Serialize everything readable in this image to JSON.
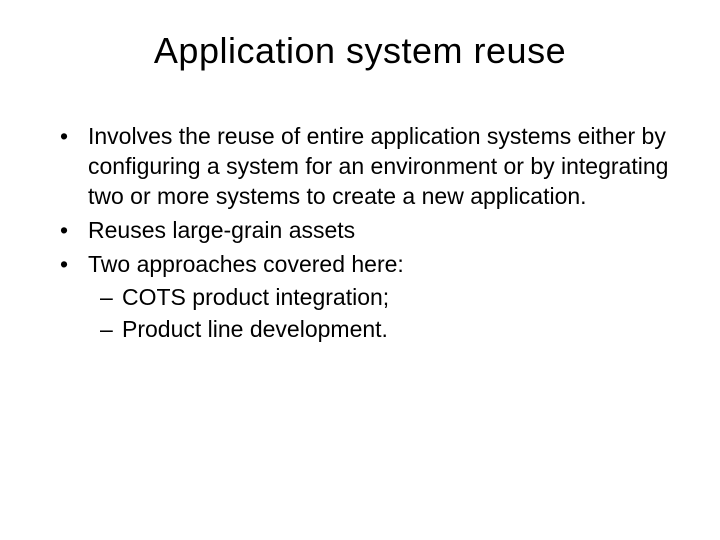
{
  "title": "Application system reuse",
  "bullets": [
    "Involves the reuse of entire application systems either by configuring a system for an environment or by integrating two or more systems to create a new application.",
    "Reuses large-grain assets",
    "Two approaches covered here:"
  ],
  "subbullets": [
    "COTS product integration;",
    "Product line development."
  ]
}
